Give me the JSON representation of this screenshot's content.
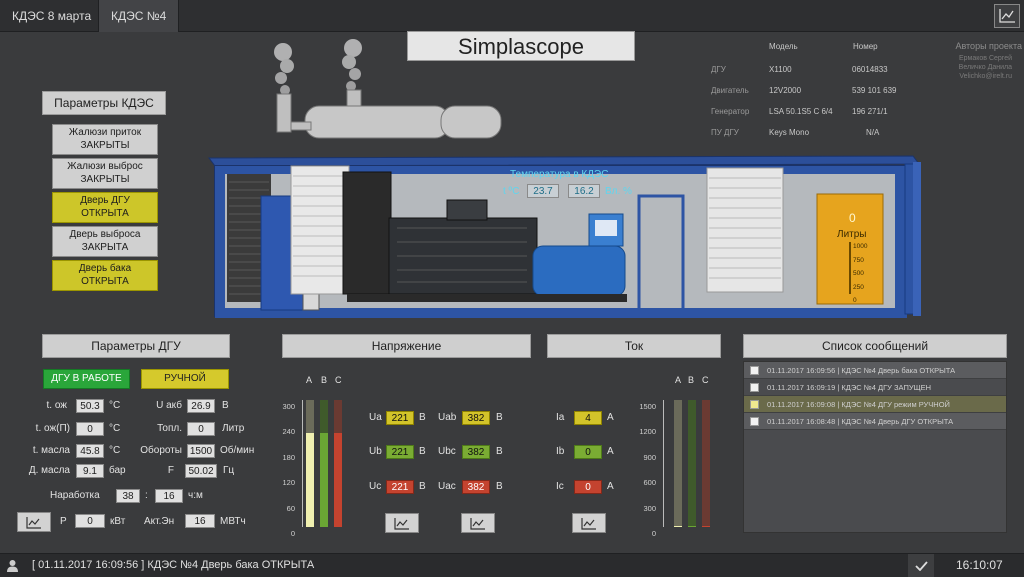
{
  "tabs": [
    {
      "label": "КДЭС 8 марта"
    },
    {
      "label": "КДЭС №4"
    }
  ],
  "app_title": "Simplascope",
  "info": {
    "col_model": "Модель",
    "col_number": "Номер",
    "rows": [
      {
        "name": "ДГУ",
        "model": "X1100",
        "number": "06014833"
      },
      {
        "name": "Двигатель",
        "model": "12V2000",
        "number": "539 101 639"
      },
      {
        "name": "Генератор",
        "model": "LSA 50.1S5 C 6/4",
        "number": "196 271/1"
      },
      {
        "name": "ПУ ДГУ",
        "model": "Keys Mono",
        "number": "N/A"
      }
    ],
    "authors_title": "Авторы проекта",
    "author1": "Ермаков Сергей",
    "author2": "Величко Данила",
    "email": "Velichko@irelt.ru"
  },
  "kdes_params": {
    "header": "Параметры КДЭС",
    "items": [
      {
        "line1": "Жалюзи приток",
        "line2": "ЗАКРЫТЫ"
      },
      {
        "line1": "Жалюзи выброс",
        "line2": "ЗАКРЫТЫ"
      },
      {
        "line1": "Дверь ДГУ",
        "line2": "ОТКРЫТА"
      },
      {
        "line1": "Дверь выброса",
        "line2": "ЗАКРЫТА"
      },
      {
        "line1": "Дверь бака",
        "line2": "ОТКРЫТА"
      }
    ]
  },
  "scene": {
    "temp_title": "Температура в КДЭС",
    "t_label": "t ºC",
    "t_value": "23.7",
    "hum_value": "16.2",
    "hum_label": "Вл. %",
    "tank_value": "0",
    "tank_label": "Литры",
    "tank_scale": [
      "1000",
      "750",
      "500",
      "250",
      "0"
    ],
    "tank_level": 0
  },
  "dgu": {
    "header": "Параметры ДГУ",
    "status_btn": "ДГУ В РАБОТЕ",
    "mode_btn": "РУЧНОЙ",
    "params": [
      {
        "label": "t. ож",
        "value": "50.3",
        "unit": "°C"
      },
      {
        "label": "t. ож(П)",
        "value": "0",
        "unit": "°C"
      },
      {
        "label": "t. масла",
        "value": "45.8",
        "unit": "°C"
      },
      {
        "label": "Д. масла",
        "value": "9.1",
        "unit": "бар"
      }
    ],
    "params2": [
      {
        "label": "U акб",
        "value": "26.9",
        "unit": "В"
      },
      {
        "label": "Топл.",
        "value": "0",
        "unit": "Литр"
      },
      {
        "label": "Обороты",
        "value": "1500",
        "unit": "Об/мин"
      },
      {
        "label": "F",
        "value": "50.02",
        "unit": "Гц"
      }
    ],
    "runtime_label": "Наработка",
    "runtime_h": "38",
    "runtime_sep": ":",
    "runtime_m": "16",
    "runtime_unit": "ч:м",
    "p_label": "P",
    "p_value": "0",
    "p_unit": "кВт",
    "energy_label": "Акт.Эн",
    "energy_value": "16",
    "energy_unit": "МВТч"
  },
  "voltage": {
    "header": "Напряжение",
    "phase_labels": [
      "A",
      "B",
      "C"
    ],
    "scale": [
      "300",
      "240",
      "180",
      "120",
      "60",
      "0"
    ],
    "scale_max": 300,
    "bars": [
      221,
      221,
      221
    ],
    "rows": [
      {
        "label": "Ua",
        "value": "221",
        "unit": "В",
        "label2": "Uab",
        "value2": "382",
        "unit2": "В",
        "color": "yellow"
      },
      {
        "label": "Ub",
        "value": "221",
        "unit": "В",
        "label2": "Ubc",
        "value2": "382",
        "unit2": "В",
        "color": "green"
      },
      {
        "label": "Uc",
        "value": "221",
        "unit": "В",
        "label2": "Uac",
        "value2": "382",
        "unit2": "В",
        "color": "red"
      }
    ]
  },
  "current": {
    "header": "Ток",
    "phase_labels": [
      "A",
      "B",
      "C"
    ],
    "scale": [
      "1500",
      "1200",
      "900",
      "600",
      "300",
      "0"
    ],
    "scale_max": 1500,
    "bars": [
      4,
      0,
      0
    ],
    "rows": [
      {
        "label": "Ia",
        "value": "4",
        "unit": "А",
        "color": "yellow"
      },
      {
        "label": "Ib",
        "value": "0",
        "unit": "А",
        "color": "green"
      },
      {
        "label": "Ic",
        "value": "0",
        "unit": "А",
        "color": "red"
      }
    ]
  },
  "messages": {
    "header": "Список сообщений",
    "items": [
      {
        "text": "01.11.2017  16:09:56 | КДЭС №4 Дверь бака ОТКРЫТА"
      },
      {
        "text": "01.11.2017  16:09:19 | КДЭС №4 ДГУ ЗАПУЩЕН"
      },
      {
        "text": "01.11.2017  16:09:08 | КДЭС №4 ДГУ режим РУЧНОЙ"
      },
      {
        "text": "01.11.2017  16:08:48 | КДЭС №4 Дверь ДГУ ОТКРЫТА"
      }
    ]
  },
  "status": {
    "message": "[ 01.11.2017  16:09:56 ]  КДЭС №4 Дверь бака ОТКРЫТА",
    "time": "16:10:07"
  },
  "colors": {
    "phase_a": "#e8e8a8",
    "phase_b": "#6aa534",
    "phase_c": "#c4432f",
    "accent_yellow": "#cdc629"
  }
}
